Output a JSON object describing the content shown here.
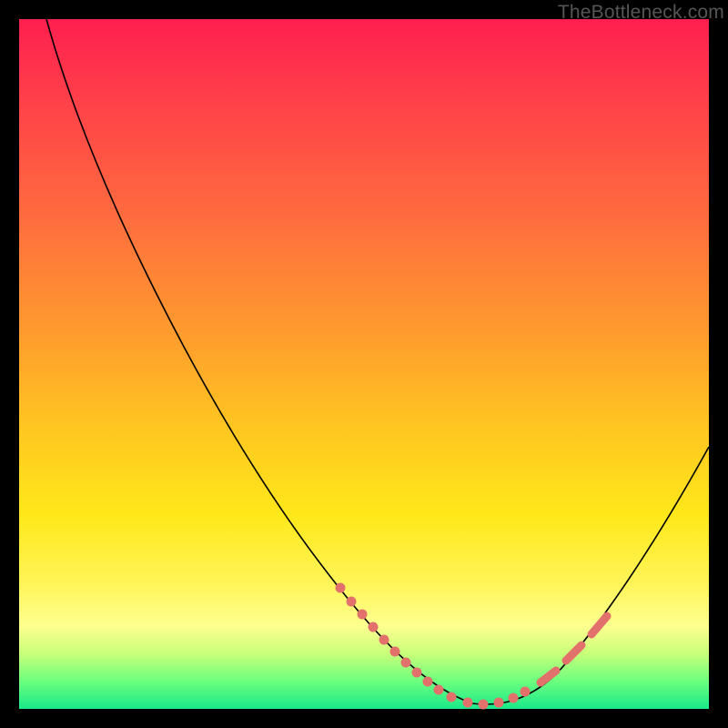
{
  "attribution": "TheBottleneck.com",
  "colors": {
    "gradient_top": "#ff1f4f",
    "gradient_mid1": "#ff9a2e",
    "gradient_mid2": "#ffe81a",
    "gradient_bottom": "#19e88a",
    "curve": "#000000",
    "markers": "#e3716b",
    "frame": "#000000"
  },
  "chart_data": {
    "type": "line",
    "title": "",
    "xlabel": "",
    "ylabel": "",
    "xlim": [
      0,
      100
    ],
    "ylim": [
      0,
      100
    ],
    "grid": false,
    "legend": false,
    "series": [
      {
        "name": "bottleneck-curve",
        "comment": "y is plotted downward; low y = near bottom (good / green). Estimated from pixel positions.",
        "x": [
          4,
          8,
          12,
          16,
          20,
          24,
          28,
          32,
          36,
          40,
          44,
          48,
          52,
          56,
          60,
          64,
          68,
          72,
          76,
          80,
          84,
          88,
          92,
          96,
          100
        ],
        "y": [
          100,
          92,
          84,
          76,
          69,
          61,
          53,
          46,
          38,
          31,
          24,
          17,
          11,
          6,
          3,
          1,
          0,
          0,
          2,
          5,
          10,
          17,
          24,
          32,
          40
        ]
      }
    ],
    "highlighted_segments": [
      {
        "name": "left-dotted-run",
        "x_start": 46,
        "x_end": 70,
        "style": "dense-dots"
      },
      {
        "name": "right-dashed-run",
        "x_start": 73,
        "x_end": 82,
        "style": "dashes"
      }
    ]
  }
}
